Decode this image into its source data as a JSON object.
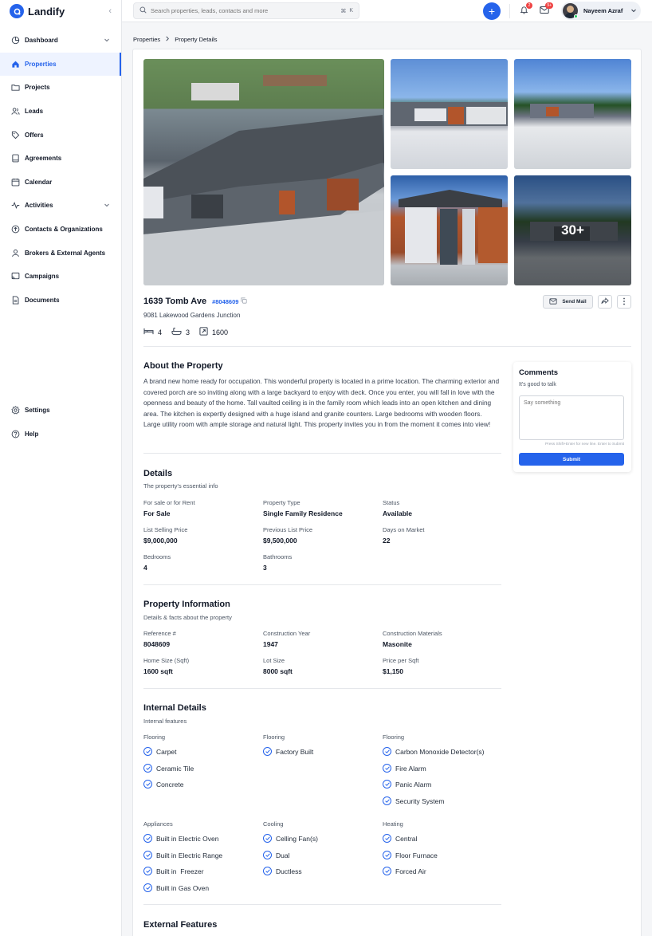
{
  "app": {
    "name": "Landify"
  },
  "sidebar": {
    "items": [
      {
        "label": "Dashboard",
        "icon": "dashboard-icon",
        "chevron": true
      },
      {
        "label": "Properties",
        "icon": "home-icon",
        "active": true
      },
      {
        "label": "Projects",
        "icon": "folder-icon"
      },
      {
        "label": "Leads",
        "icon": "users-icon"
      },
      {
        "label": "Offers",
        "icon": "tag-icon"
      },
      {
        "label": "Agreements",
        "icon": "book-icon"
      },
      {
        "label": "Calendar",
        "icon": "calendar-icon"
      },
      {
        "label": "Activities",
        "icon": "activity-icon",
        "chevron": true
      },
      {
        "label": "Contacts & Organizations",
        "icon": "contacts-icon"
      },
      {
        "label": "Brokers & External Agents",
        "icon": "user-icon"
      },
      {
        "label": "Campaigns",
        "icon": "campaign-icon"
      },
      {
        "label": "Documents",
        "icon": "document-icon"
      }
    ],
    "bottom_items": [
      {
        "label": "Settings",
        "icon": "gear-icon"
      },
      {
        "label": "Help",
        "icon": "help-icon"
      }
    ]
  },
  "topbar": {
    "search_placeholder": "Search properties, leads, contacts and more",
    "shortcut_cmd": "⌘",
    "shortcut_key": "K",
    "notifications_count": "2",
    "messages_count": "9+",
    "user_name": "Nayeem Azraf"
  },
  "breadcrumb": {
    "parent": "Properties",
    "current": "Property Details"
  },
  "gallery": {
    "more_label": "30+"
  },
  "property": {
    "title": "1639 Tomb Ave",
    "reference": "#8048609",
    "address": "9081 Lakewood Gardens Junction",
    "beds": "4",
    "baths": "3",
    "area": "1600"
  },
  "actions": {
    "send_mail": "Send Mail"
  },
  "about": {
    "title": "About the Property",
    "text": "A brand new home ready for occupation. This wonderful property is located in a prime location. The charming exterior and covered porch are so inviting along with a large backyard to enjoy with deck. Once you enter, you will fall in love with the openness and beauty of the home. Tall vaulted ceiling is in the family room which leads into an open kitchen and dining area. The kitchen is expertly designed with a huge island and granite counters. Large bedrooms with wooden floors. Large utility room with ample storage and natural light. This property invites you in from the moment it comes into view!"
  },
  "details": {
    "title": "Details",
    "subtitle": "The property's essential info",
    "fields": [
      {
        "label": "For sale or for Rent",
        "value": "For Sale"
      },
      {
        "label": "Property Type",
        "value": "Single Family Residence"
      },
      {
        "label": "Status",
        "value": "Available"
      },
      {
        "label": "List Selling Price",
        "value": "$9,000,000"
      },
      {
        "label": "Previous List Price",
        "value": "$9,500,000"
      },
      {
        "label": "Days on Market",
        "value": "22"
      },
      {
        "label": "Bedrooms",
        "value": "4"
      },
      {
        "label": "Bathrooms",
        "value": "3"
      }
    ]
  },
  "info": {
    "title": "Property Information",
    "subtitle": "Details & facts about the property",
    "fields": [
      {
        "label": "Reference #",
        "value": "8048609"
      },
      {
        "label": "Construction Year",
        "value": "1947"
      },
      {
        "label": "Construction Materials",
        "value": "Masonite"
      },
      {
        "label": "Home Size (Sqft)",
        "value": "1600 sqft"
      },
      {
        "label": "Lot Size",
        "value": "8000 sqft"
      },
      {
        "label": "Price per Sqft",
        "value": "$1,150"
      }
    ]
  },
  "internal": {
    "title": "Internal Details",
    "subtitle": "Internal features",
    "groups": [
      {
        "head": "Flooring",
        "items": [
          "Carpet",
          "Ceramic Tile",
          "Concrete"
        ]
      },
      {
        "head": "Flooring",
        "items": [
          "Factory Built"
        ]
      },
      {
        "head": "Flooring",
        "items": [
          "Carbon Monoxide Detector(s)",
          "Fire Alarm",
          "Panic Alarm",
          "Security System"
        ]
      },
      {
        "head": "Appliances",
        "items": [
          "Built in Electric Oven",
          "Built in Electric Range",
          "Built in  Freezer",
          "Built in Gas Oven"
        ]
      },
      {
        "head": "Cooling",
        "items": [
          "Celling Fan(s)",
          "Dual",
          "Ductless"
        ]
      },
      {
        "head": "Heating",
        "items": [
          "Central",
          "Floor Furnace",
          "Forced Air"
        ]
      }
    ]
  },
  "external": {
    "title": "External Features"
  },
  "comments": {
    "title": "Comments",
    "subtitle": "It's good to talk",
    "placeholder": "Say something",
    "hint": "Press Shift+Enter for new line. Enter to Submit",
    "submit": "Submit"
  },
  "colors": {
    "accent": "#2563eb",
    "danger": "#ef4444",
    "online": "#22c55e"
  }
}
